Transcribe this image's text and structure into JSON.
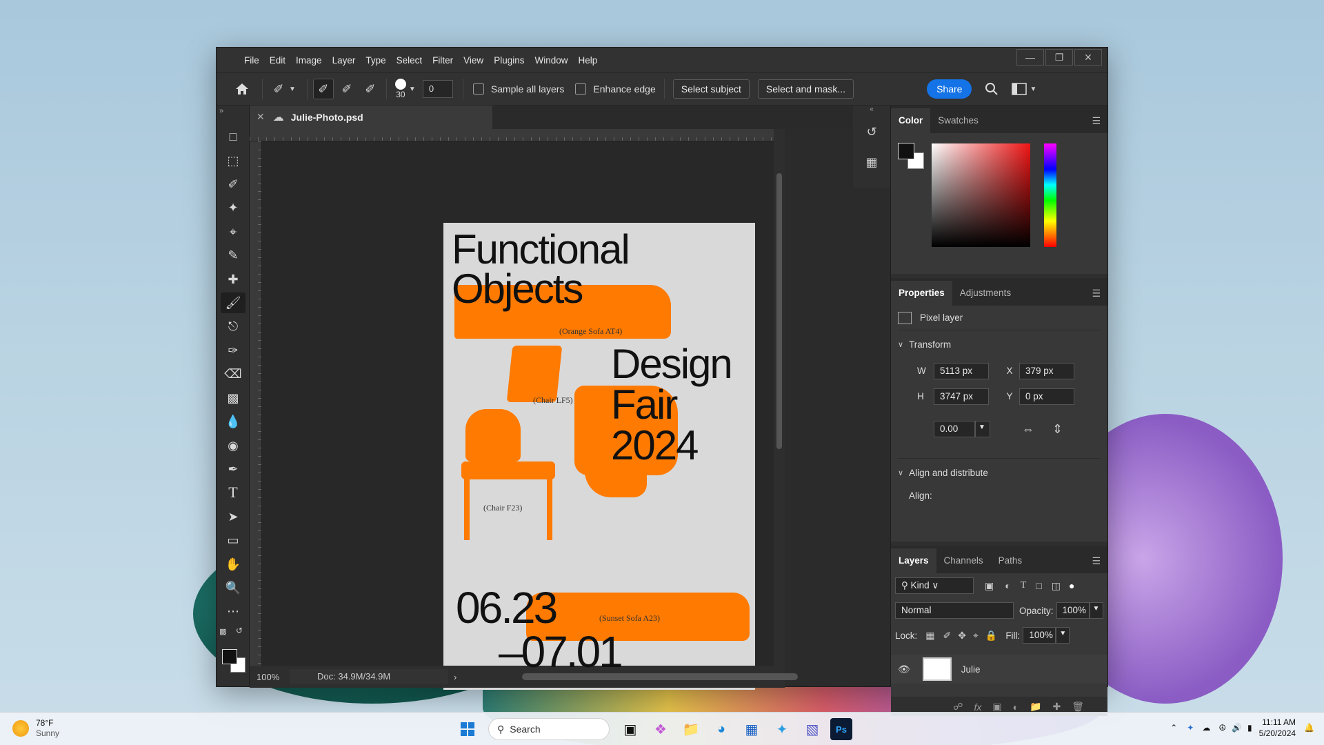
{
  "menu": [
    "File",
    "Edit",
    "Image",
    "Layer",
    "Type",
    "Select",
    "Filter",
    "View",
    "Plugins",
    "Window",
    "Help"
  ],
  "options": {
    "brush_size": "30",
    "hardness_value": "0",
    "sample_all_layers": "Sample all layers",
    "enhance_edge": "Enhance edge",
    "select_subject": "Select subject",
    "select_and_mask": "Select and mask...",
    "share": "Share"
  },
  "document": {
    "tab_name": "Julie-Photo.psd",
    "zoom": "100%",
    "doc_size": "Doc:  34.9M/34.9M"
  },
  "poster": {
    "title_line1": "Functional",
    "title_line2": "Objects",
    "event_line1": "Design",
    "event_line2": "Fair",
    "event_line3": "2024",
    "date_line1": "06.23",
    "date_line2": "–07.01",
    "caption_orange_sofa": "(Orange Sofa AT4)",
    "caption_chair_lf5": "(Chair LF5)",
    "caption_chair_f23": "(Chair F23)",
    "caption_sunset_sofa": "(Sunset Sofa A23)"
  },
  "color_panel": {
    "tabs": [
      "Color",
      "Swatches"
    ],
    "foreground": "#111111",
    "background": "#ffffff"
  },
  "properties": {
    "tabs": [
      "Properties",
      "Adjustments"
    ],
    "layer_type": "Pixel layer",
    "transform_label": "Transform",
    "w_label": "W",
    "w_value": "5113 px",
    "h_label": "H",
    "h_value": "3747 px",
    "x_label": "X",
    "x_value": "379 px",
    "y_label": "Y",
    "y_value": "0 px",
    "angle_value": "0.00",
    "align_section": "Align and distribute",
    "align_label": "Align:"
  },
  "layers": {
    "tabs": [
      "Layers",
      "Channels",
      "Paths"
    ],
    "filter_kind": "Kind",
    "blend_mode": "Normal",
    "opacity_label": "Opacity:",
    "opacity_value": "100%",
    "lock_label": "Lock:",
    "fill_label": "Fill:",
    "fill_value": "100%",
    "layer_name": "Julie"
  },
  "taskbar": {
    "temperature": "78°F",
    "condition": "Sunny",
    "search": "Search",
    "time": "11:11 AM",
    "date": "5/20/2024"
  },
  "colors": {
    "accent": "#1473e6",
    "poster_orange": "#ff7a00"
  }
}
